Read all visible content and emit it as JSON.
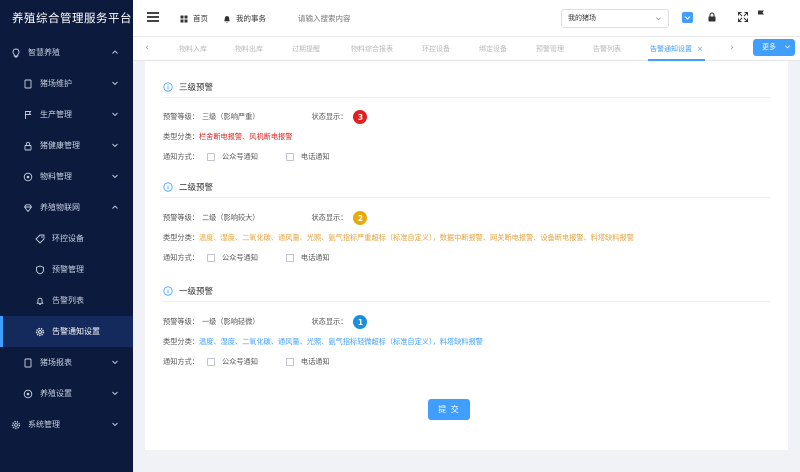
{
  "sidebar": {
    "app_title": "养殖综合管理服务平台",
    "menu": [
      {
        "label": "智慧养殖",
        "icon": "bulb-icon"
      },
      {
        "label": "猪场维护",
        "icon": "tablet-icon"
      },
      {
        "label": "生产管理",
        "icon": "flag-icon"
      },
      {
        "label": "猪健康管理",
        "icon": "lock-icon"
      },
      {
        "label": "物料管理",
        "icon": "target-icon"
      },
      {
        "label": "养殖物联网",
        "icon": "diamond-icon"
      },
      {
        "label": "环控设备",
        "icon": "tag-icon"
      },
      {
        "label": "预警管理",
        "icon": "shield-icon"
      },
      {
        "label": "告警列表",
        "icon": "bell-icon"
      },
      {
        "label": "告警通知设置",
        "icon": "gear-icon"
      },
      {
        "label": "猪场报表",
        "icon": "tablet-icon"
      },
      {
        "label": "养殖设置",
        "icon": "target-icon"
      },
      {
        "label": "系统管理",
        "icon": "gear-icon"
      }
    ]
  },
  "topbar": {
    "home_label": "首页",
    "my_tasks_label": "我的事务",
    "search_placeholder": "请输入搜索内容",
    "farm_select_value": "我的猪场"
  },
  "tabs": {
    "items": [
      "物料入库",
      "物料出库",
      "过期提醒",
      "物料综合报表",
      "环控设备",
      "绑定设备",
      "预警管理",
      "告警列表",
      "告警通知设置"
    ],
    "active_index": 8,
    "more_label": "更多"
  },
  "form": {
    "labels": {
      "level": "预警等级：",
      "status": "状态显示：",
      "category": "类型分类：",
      "notify": "通知方式：",
      "wechat": "公众号通知",
      "phone": "电话通知"
    },
    "sections": [
      {
        "title": "三级预警",
        "level_value": "三级（影响严重）",
        "badge": "3",
        "badge_color": "#e02020",
        "category_text": "栏舍断电报警、风机断电报警",
        "category_color": "#e02020"
      },
      {
        "title": "二级预警",
        "level_value": "二级（影响较大）",
        "badge": "2",
        "badge_color": "#e8a90c",
        "category_text": "温度、湿度、二氧化碳、通风量、光照、氨气指标严重超标（标准自定义），数据中断报警、网关断电报警、设备断电报警、料塔缺料报警",
        "category_color": "#e6a23c"
      },
      {
        "title": "一级预警",
        "level_value": "一级（影响轻微）",
        "badge": "1",
        "badge_color": "#1a8fe0",
        "category_text": "温度、湿度、二氧化碳、通风量、光照、氨气指标轻微超标（标准自定义），料塔缺料报警",
        "category_color": "#409eff"
      }
    ],
    "submit_label": "提 交"
  },
  "colors": {
    "accent": "#409eff",
    "sidebar_bg": "#0b1a3d"
  }
}
